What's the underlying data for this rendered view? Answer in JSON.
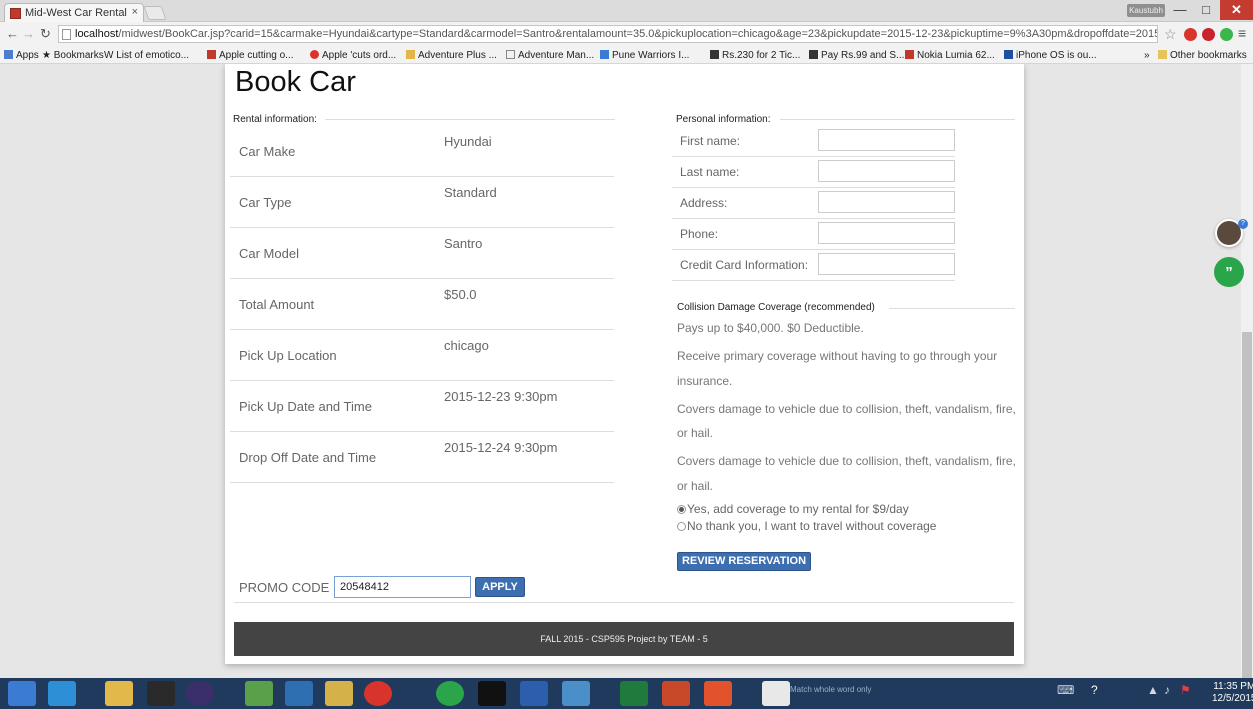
{
  "browser": {
    "tab_title": "Mid-West Car Rental",
    "tab_close": "×",
    "profile": "Kaustubh",
    "url_host": "localhost",
    "url_rest": "/midwest/BookCar.jsp?carid=15&carmake=Hyundai&cartype=Standard&carmodel=Santro&rentalamount=35.0&pickuplocation=chicago&age=23&pickupdate=2015-12-23&pickuptime=9%3A30pm&dropoffdate=2015-",
    "bookmarks": [
      "Apps",
      "Bookmarks",
      "List of emotico...",
      "Apple cutting o...",
      "Apple 'cuts ord...",
      "Adventure Plus ...",
      "Adventure Man...",
      "Pune Warriors I...",
      "Rs.230 for 2 Tic...",
      "Pay Rs.99 and S...",
      "Nokia Lumia 62...",
      "iPhone OS is ou..."
    ],
    "other_bookmarks": "Other bookmarks",
    "more_bookmarks": "»"
  },
  "page": {
    "title": "Book Car",
    "rental_section": "Rental information:",
    "rental": [
      {
        "label": "Car Make",
        "value": "Hyundai"
      },
      {
        "label": "Car Type",
        "value": "Standard"
      },
      {
        "label": "Car Model",
        "value": "Santro"
      },
      {
        "label": "Total Amount",
        "value": "$50.0"
      },
      {
        "label": "Pick Up Location",
        "value": "chicago"
      },
      {
        "label": "Pick Up Date and Time",
        "value": "2015-12-23 9:30pm"
      },
      {
        "label": "Drop Off Date and Time",
        "value": "2015-12-24 9:30pm"
      }
    ],
    "personal_section": "Personal information:",
    "personal": [
      {
        "label": "First name:"
      },
      {
        "label": "Last name:"
      },
      {
        "label": "Address:"
      },
      {
        "label": "Phone:"
      },
      {
        "label": "Credit Card Information:"
      }
    ],
    "coverage_section": "Collision Damage Coverage (recommended)",
    "coverage_lines": [
      "Pays up to $40,000. $0 Deductible.",
      "Receive primary coverage without having to go through your",
      "insurance.",
      "Covers damage to vehicle due to collision, theft, vandalism, fire,",
      "or hail.",
      "Covers damage to vehicle due to collision, theft, vandalism, fire,",
      "or hail."
    ],
    "coverage_yes": "Yes, add coverage to my rental for $9/day",
    "coverage_no": "No thank you, I want to travel without coverage",
    "review_button": "REVIEW RESERVATION",
    "promo_label": "PROMO CODE",
    "promo_value": "20548412",
    "apply_button": "APPLY",
    "footer": "FALL 2015 - CSP595 Project by TEAM - 5"
  },
  "taskbar": {
    "search_hint": "Match whole word only",
    "clock_time": "11:35 PM",
    "clock_date": "12/5/2015"
  }
}
